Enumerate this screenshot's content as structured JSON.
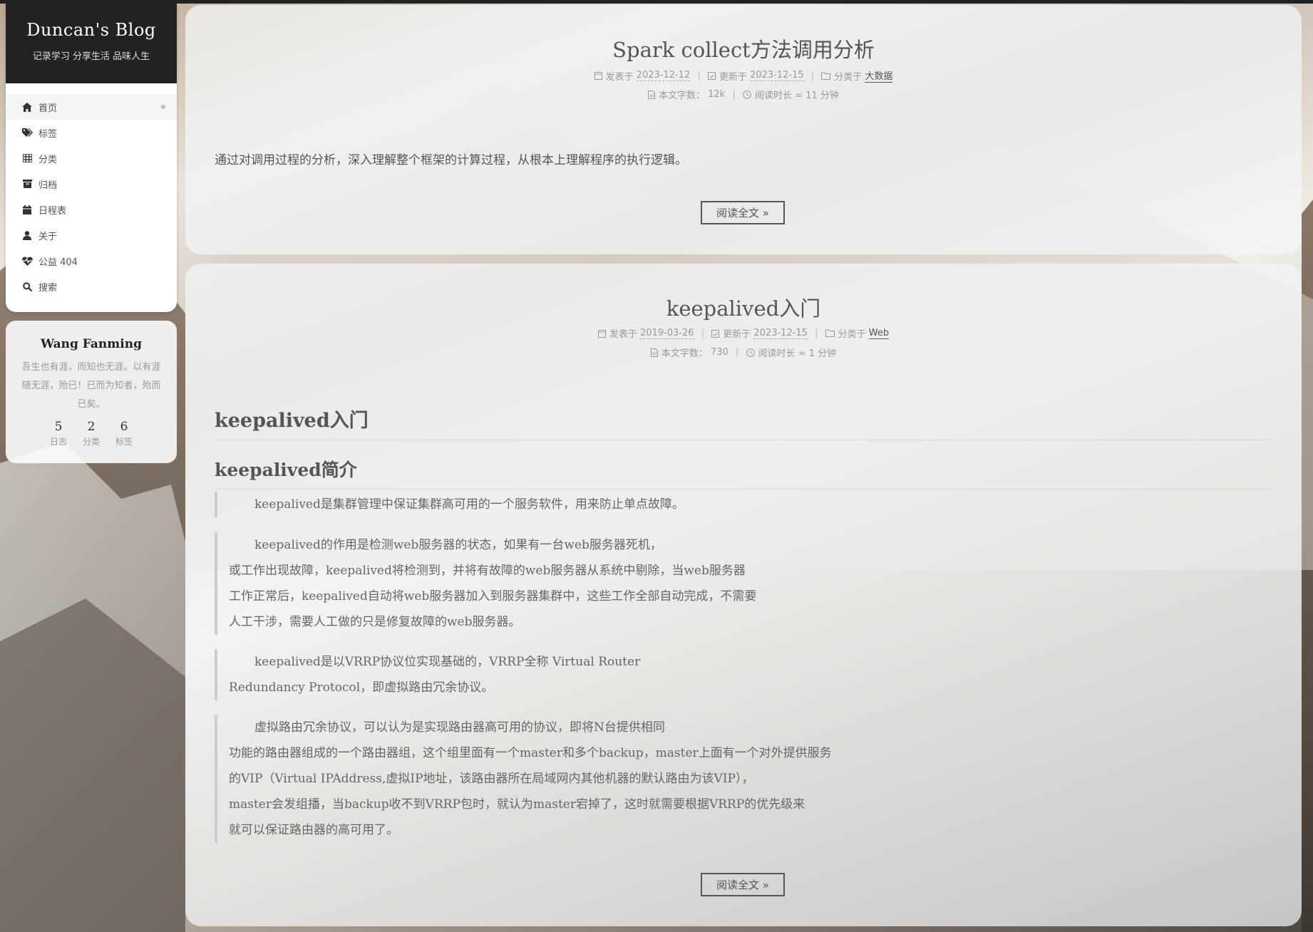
{
  "site": {
    "title": "Duncan's Blog",
    "subtitle": "记录学习 分享生活 品味人生"
  },
  "menu": [
    {
      "label": "首页",
      "icon": "home-icon",
      "active": true
    },
    {
      "label": "标签",
      "icon": "tags-icon"
    },
    {
      "label": "分类",
      "icon": "th-icon"
    },
    {
      "label": "归档",
      "icon": "archive-icon"
    },
    {
      "label": "日程表",
      "icon": "calendar-icon"
    },
    {
      "label": "关于",
      "icon": "user-icon"
    },
    {
      "label": "公益 404",
      "icon": "heartbeat-icon"
    },
    {
      "label": "搜索",
      "icon": "search-icon"
    }
  ],
  "author": {
    "name": "Wang Fanming",
    "description": "吾生也有涯，而知也无涯。以有涯随无涯，殆已！已而为知者，殆而已矣。",
    "stats": [
      {
        "count": "5",
        "label": "日志"
      },
      {
        "count": "2",
        "label": "分类"
      },
      {
        "count": "6",
        "label": "标签"
      }
    ]
  },
  "labels": {
    "posted": "发表于",
    "updated": "更新于",
    "category": "分类于",
    "words": "本文字数：",
    "reading": "阅读时长 ≈",
    "read_more": "阅读全文 »"
  },
  "posts": [
    {
      "title": "Spark collect方法调用分析",
      "posted": "2023-12-12",
      "updated": "2023-12-15",
      "category": "大数据",
      "words": "12k",
      "reading": "11 分钟",
      "excerpt": "通过对调用过程的分析，深入理解整个框架的计算过程，从根本上理解程序的执行逻辑。"
    },
    {
      "title": "keepalived入门",
      "posted": "2019-03-26",
      "updated": "2023-12-15",
      "category": "Web",
      "words": "730",
      "reading": "1 分钟",
      "h1": "keepalived入门",
      "h2": "keepalived简介",
      "quotes": [
        [
          "keepalived是集群管理中保证集群高可用的一个服务软件，用来防止单点故障。"
        ],
        [
          "keepalived的作用是检测web服务器的状态，如果有一台web服务器死机，",
          "或工作出现故障，keepalived将检测到，并将有故障的web服务器从系统中剔除，当web服务器",
          "工作正常后，keepalived自动将web服务器加入到服务器集群中，这些工作全部自动完成，不需要",
          "人工干涉，需要人工做的只是修复故障的web服务器。"
        ],
        [
          "keepalived是以VRRP协议位实现基础的，VRRP全称 Virtual Router",
          "Redundancy Protocol，即虚拟路由冗余协议。"
        ],
        [
          "虚拟路由冗余协议，可以认为是实现路由器高可用的协议，即将N台提供相同",
          "功能的路由器组成的一个路由器组，这个组里面有一个master和多个backup，master上面有一个对外提供服务",
          "的VIP（Virtual IPAddress,虚拟IP地址，该路由器所在局域网内其他机器的默认路由为该VIP），",
          "master会发组播，当backup收不到VRRP包时，就认为master宕掉了，这时就需要根据VRRP的优先级来",
          "就可以保证路由器的高可用了。"
        ]
      ]
    }
  ]
}
